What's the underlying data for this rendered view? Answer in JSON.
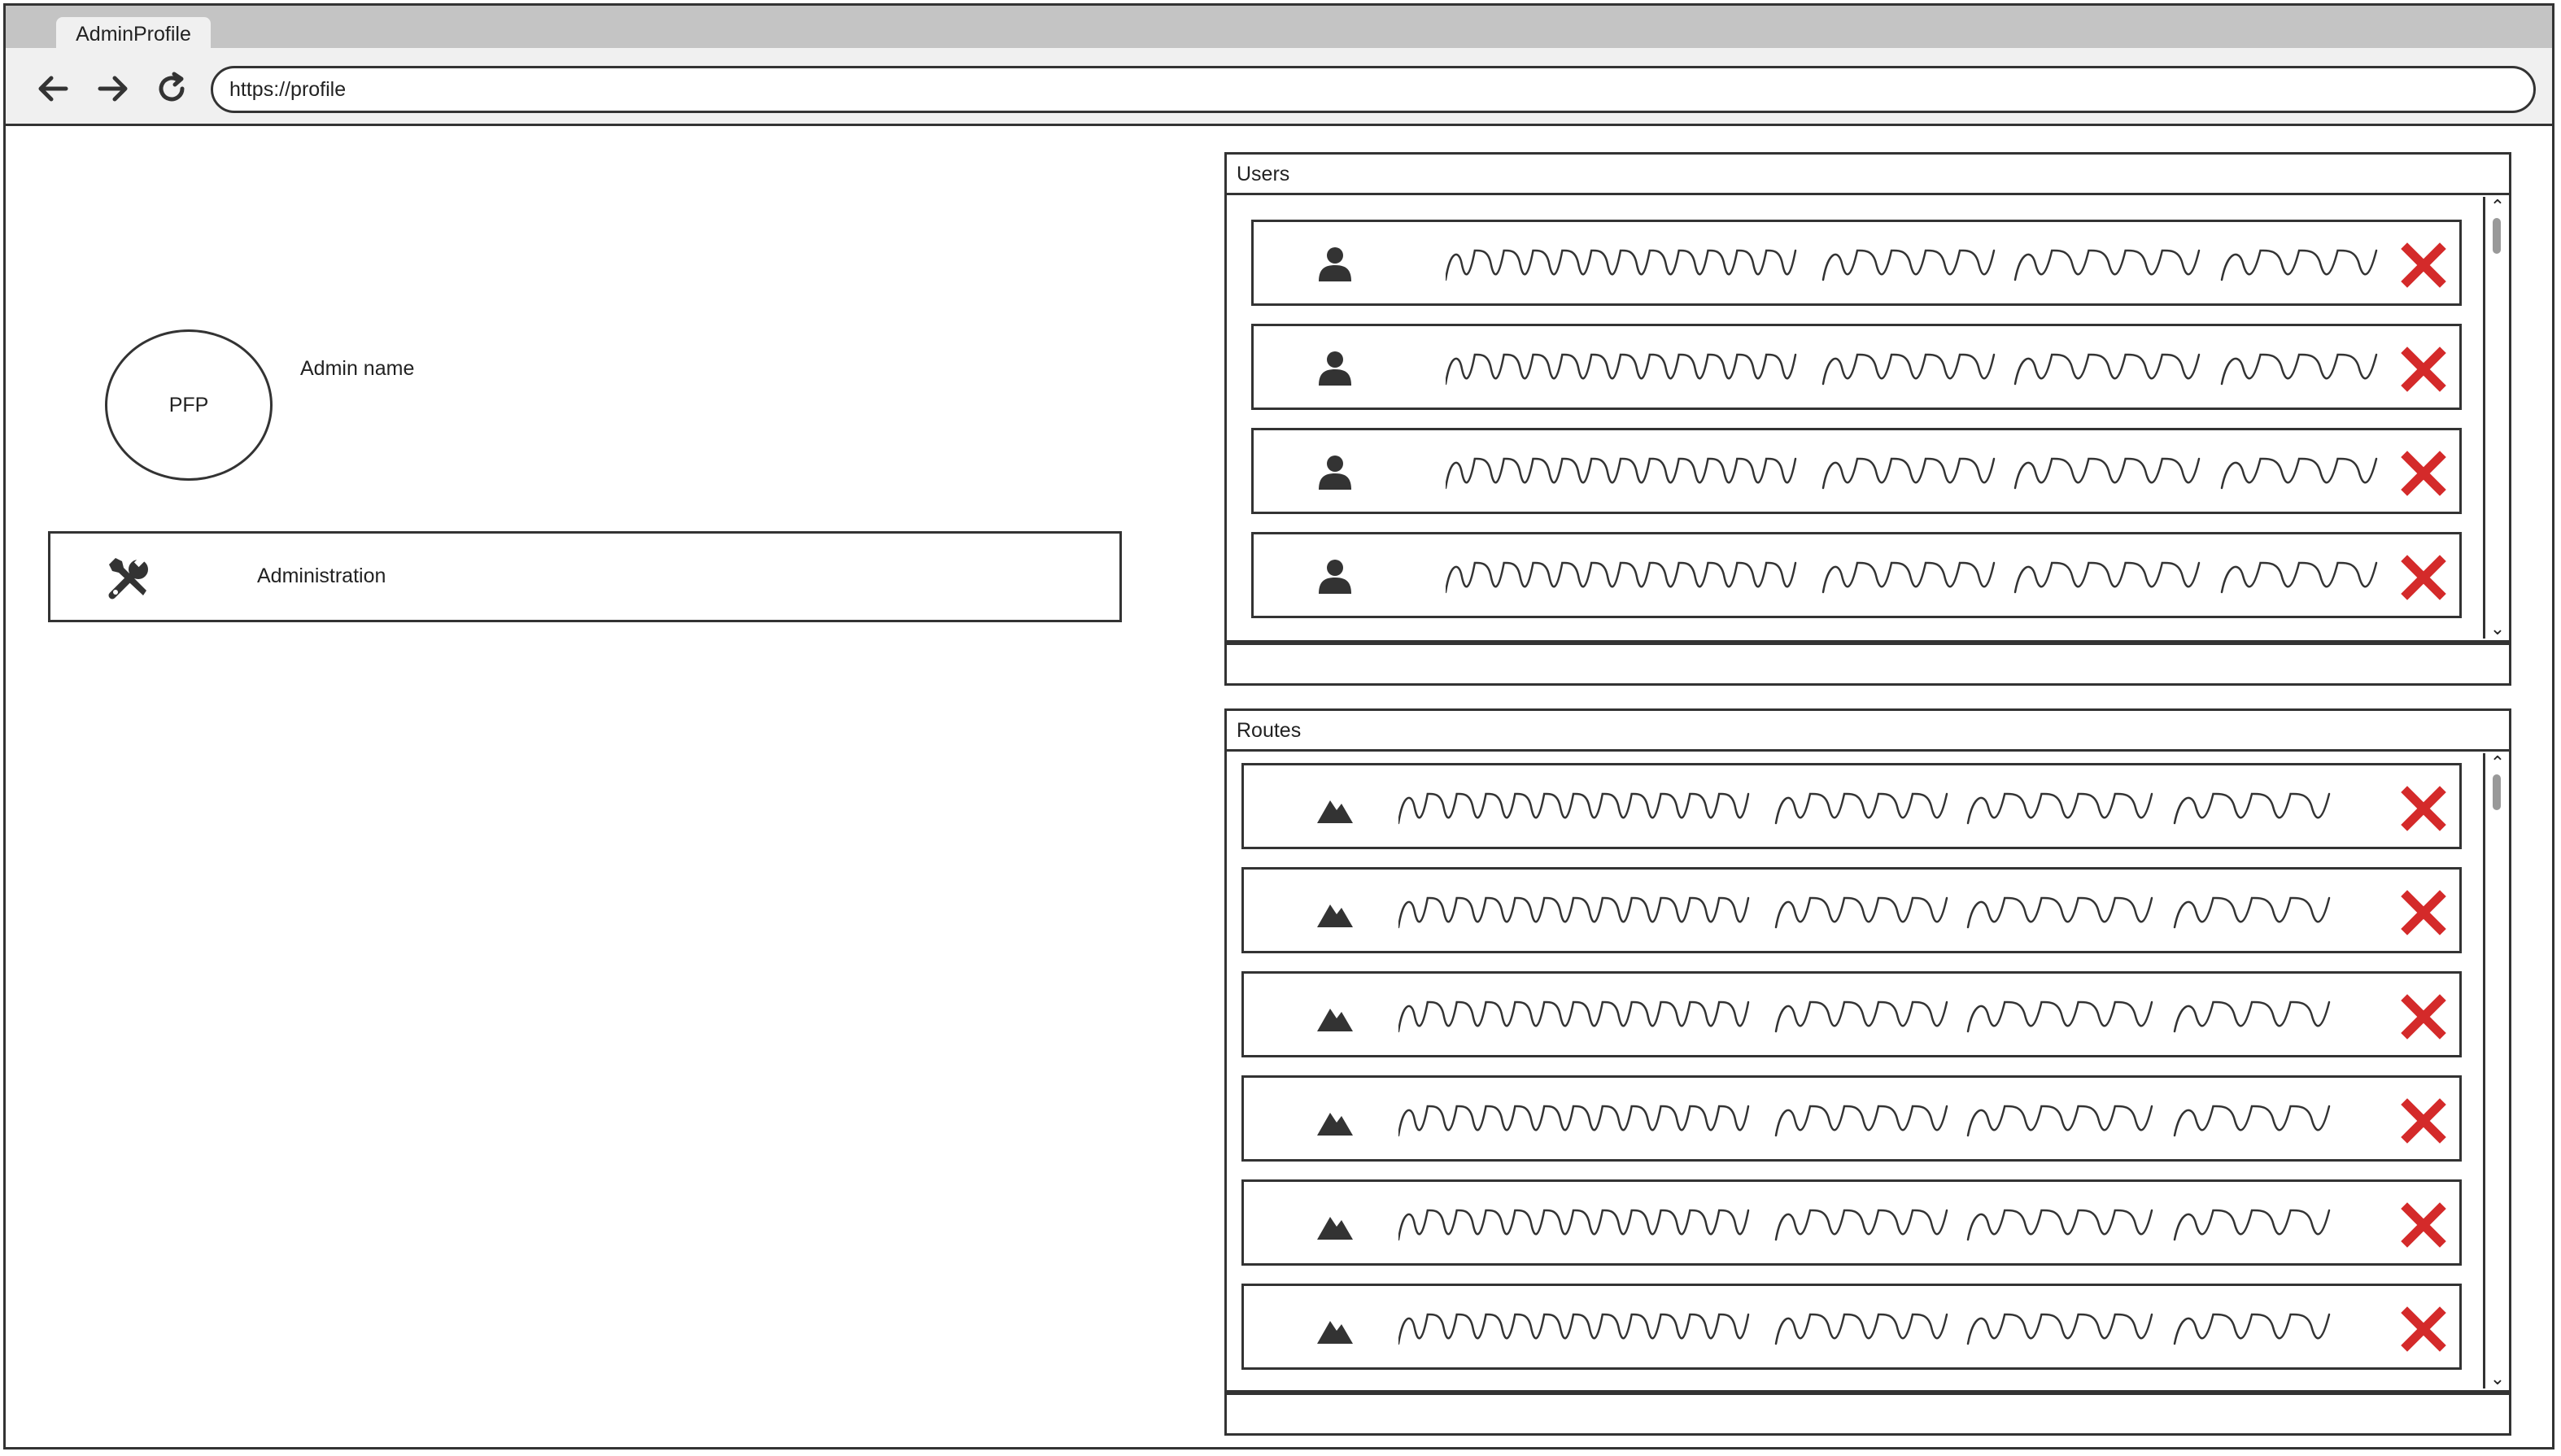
{
  "browser": {
    "tab_title": "AdminProfile",
    "url": "https://profile",
    "icons": [
      "back-icon",
      "forward-icon",
      "reload-icon"
    ]
  },
  "profile": {
    "avatar_text": "PFP",
    "admin_name": "Admin name",
    "admin_menu_label": "Administration",
    "admin_menu_icon": "tools-icon"
  },
  "users_panel": {
    "title": "Users",
    "item_count": 4,
    "item_icon": "user-icon",
    "delete_icon": "close-icon",
    "delete_color": "#d42a2a"
  },
  "routes_panel": {
    "title": "Routes",
    "item_count": 6,
    "item_icon": "mountain-icon",
    "delete_icon": "close-icon",
    "delete_color": "#d42a2a"
  }
}
